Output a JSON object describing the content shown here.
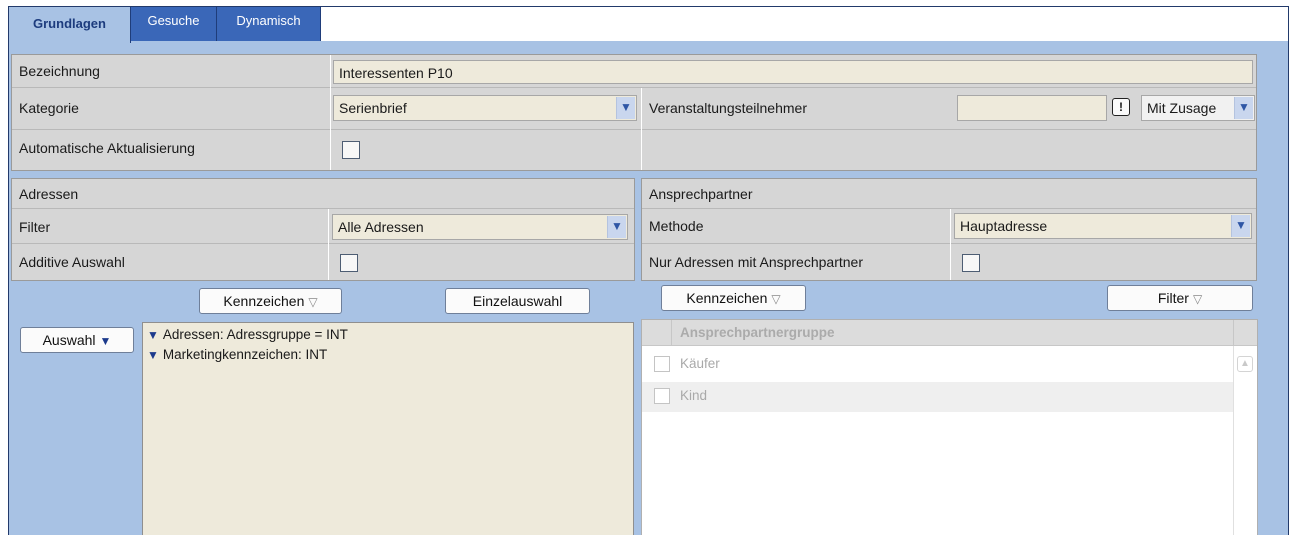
{
  "tabs": [
    {
      "label": "Grundlagen",
      "active": true
    },
    {
      "label": "Gesuche",
      "active": false
    },
    {
      "label": "Dynamisch",
      "active": false
    }
  ],
  "general": {
    "bezeichnung_label": "Bezeichnung",
    "bezeichnung_value": "Interessenten P10",
    "kategorie_label": "Kategorie",
    "kategorie_value": "Serienbrief",
    "veranstaltung_label": "Veranstaltungsteilnehmer",
    "veranstaltung_value": "",
    "veranstaltung_alert_icon": "!",
    "zusage_value": "Mit Zusage",
    "auto_update_label": "Automatische Aktualisierung",
    "auto_update_checked": false
  },
  "adressen": {
    "title": "Adressen",
    "filter_label": "Filter",
    "filter_value": "Alle Adressen",
    "additive_label": "Additive Auswahl",
    "additive_checked": false,
    "kennzeichen_button": "Kennzeichen",
    "einzelauswahl_button": "Einzelauswahl",
    "auswahl_button": "Auswahl",
    "filter_items": [
      "Adressen: Adressgruppe = INT",
      "Marketingkennzeichen: INT"
    ]
  },
  "ansprechpartner": {
    "title": "Ansprechpartner",
    "methode_label": "Methode",
    "methode_value": "Hauptadresse",
    "nur_adressen_label": "Nur Adressen mit Ansprechpartner",
    "nur_adressen_checked": false,
    "kennzeichen_button": "Kennzeichen",
    "filter_button": "Filter",
    "grid_header": "Ansprechpartnergruppe",
    "grid_rows": [
      "Käufer",
      "Kind"
    ]
  },
  "icons": {
    "dropdown": "chevron-down-icon",
    "funnel": "filter-funnel-icon",
    "alert": "exclamation-icon"
  },
  "colors": {
    "tab_active_text": "#1d3c7e",
    "tab_inactive_bg": "#3a67b8",
    "frame_bg": "#a8c2e4",
    "panel_bg": "#d6d6d6",
    "field_bg": "#eeeadb"
  }
}
